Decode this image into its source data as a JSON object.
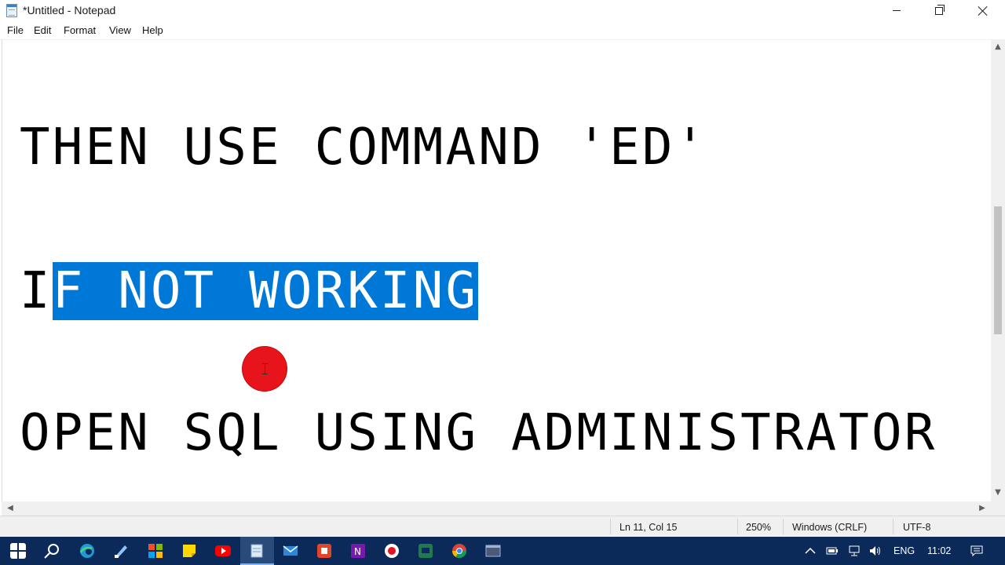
{
  "window": {
    "title": "*Untitled - Notepad"
  },
  "menu": {
    "items": [
      "File",
      "Edit",
      "Format",
      "View",
      "Help"
    ]
  },
  "editor": {
    "line1": "THEN USE COMMAND 'ED'",
    "line2_before": "I",
    "line2_selected": "F NOT WORKING",
    "line3": "OPEN SQL USING ADMINISTRATOR",
    "selection_color": "#0078d7"
  },
  "status": {
    "position": "Ln 11, Col 15",
    "zoom": "250%",
    "line_ending": "Windows (CRLF)",
    "encoding": "UTF-8"
  },
  "taskbar": {
    "language": "ENG",
    "time": "11:02",
    "apps": [
      "start-icon",
      "search-icon",
      "edge-icon",
      "paint-icon",
      "files-icon",
      "sticky-notes-icon",
      "youtube-icon",
      "notepad-icon",
      "mail-icon",
      "powerpoint-icon",
      "onenote-icon",
      "record-icon",
      "app-icon",
      "chrome-icon",
      "terminal-icon"
    ]
  }
}
